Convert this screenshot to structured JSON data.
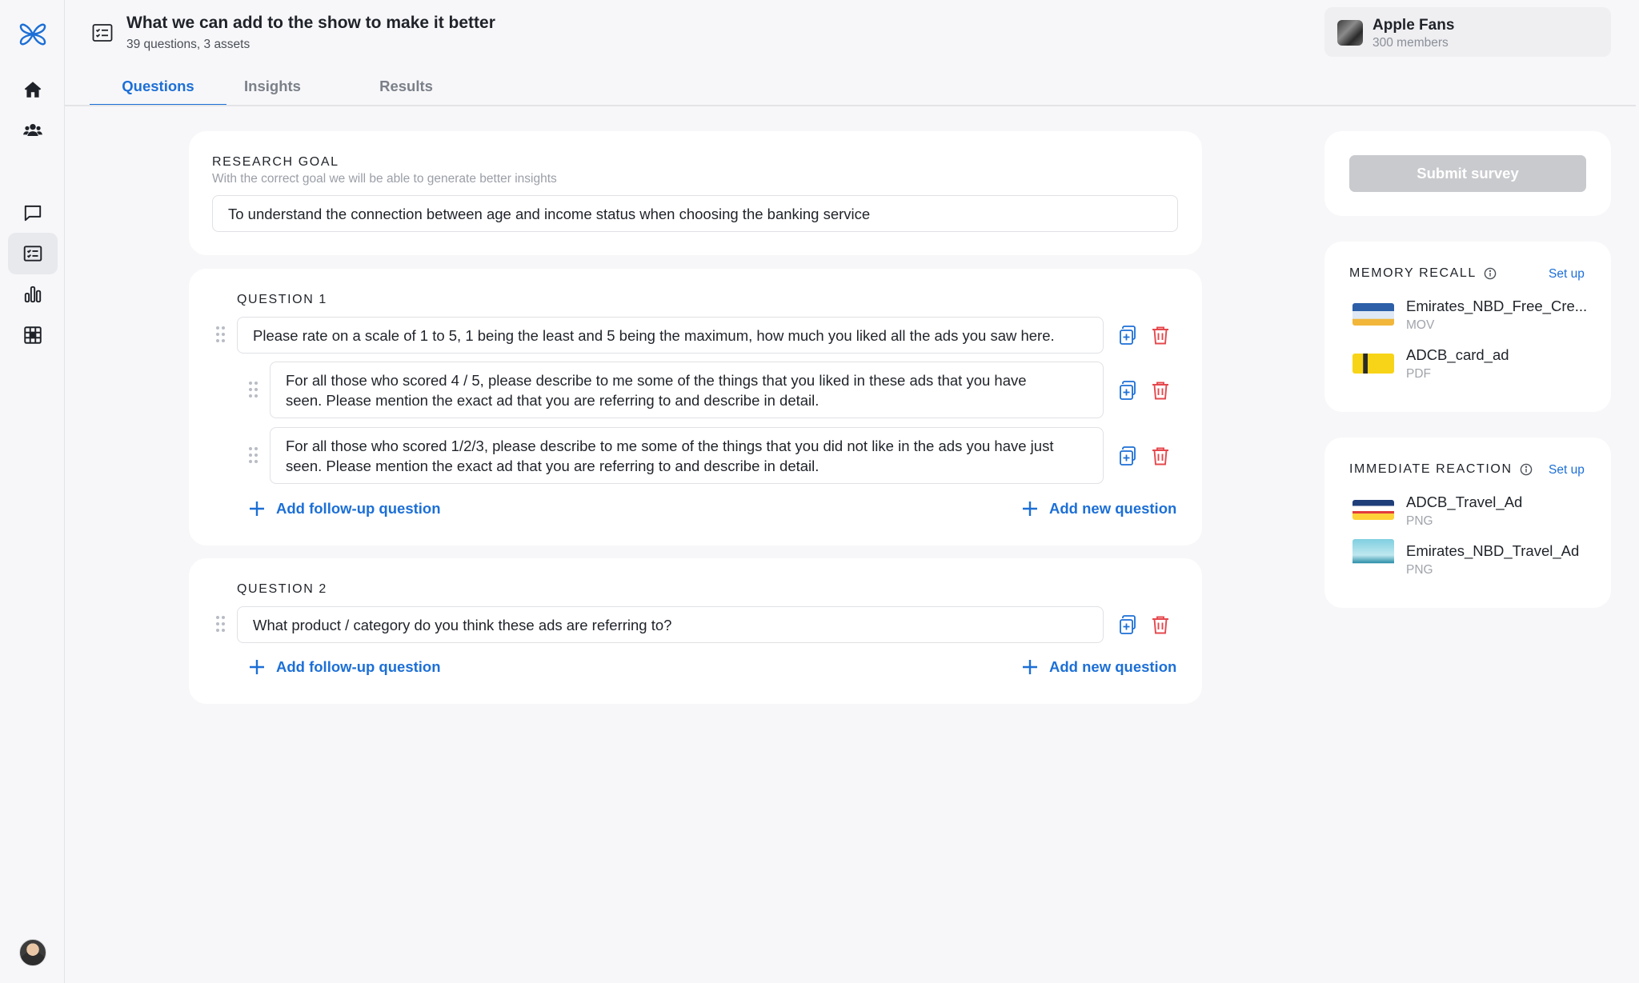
{
  "app": {
    "logo_icon": "butterfly-logo-icon",
    "accent_color": "#1c6fd6",
    "danger_color": "#e5484d"
  },
  "sidebar": {
    "items": [
      {
        "name": "home",
        "icon": "home-icon"
      },
      {
        "name": "audience",
        "icon": "users-icon"
      },
      {
        "name": "chat",
        "icon": "chat-icon"
      },
      {
        "name": "surveys",
        "icon": "survey-list-icon",
        "active": true
      },
      {
        "name": "analytics",
        "icon": "bar-chart-icon"
      },
      {
        "name": "grid",
        "icon": "grid-icon"
      }
    ]
  },
  "header": {
    "title": "What we can add to the show to make it better",
    "subtitle": "39 questions, 3 assets",
    "group": {
      "name": "Apple Fans",
      "members": "300 members"
    }
  },
  "tabs": [
    {
      "label": "Questions",
      "active": true
    },
    {
      "label": "Insights",
      "active": false
    },
    {
      "label": "Results",
      "active": false
    }
  ],
  "research_goal": {
    "label": "RESEARCH GOAL",
    "helper": "With the correct goal we will be able to generate better insights",
    "value": "To understand the connection between age and income status when choosing the banking service"
  },
  "questions": [
    {
      "label": "QUESTION 1",
      "text": "Please rate on a scale of 1 to 5, 1 being the least and 5 being the maximum, how much you liked all the ads you saw here.",
      "followups": [
        {
          "line1": "For all those who scored 4 / 5, please describe to me some of the things that you liked in these ads that you have",
          "line2": "seen. Please mention the exact ad that you are referring to and describe in detail."
        },
        {
          "line1": "For all those who scored 1/2/3, please describe to me some of the things that you did not like in the ads you have just",
          "line2": "seen. Please mention the exact ad that you are referring to and describe in detail."
        }
      ],
      "add_followup": "Add follow-up question",
      "add_new": "Add new question"
    },
    {
      "label": "QUESTION 2",
      "text": "What product / category do you think these ads are referring to?",
      "followups": [],
      "add_followup": "Add follow-up question",
      "add_new": "Add new question"
    }
  ],
  "right_panel": {
    "submit_label": "Submit survey",
    "memory_recall": {
      "title": "MEMORY RECALL",
      "setup_label": "Set up",
      "assets": [
        {
          "name": "Emirates_NBD_Free_Cre...",
          "type": "MOV"
        },
        {
          "name": "ADCB_card_ad",
          "type": "PDF"
        }
      ]
    },
    "immediate_reaction": {
      "title": "IMMEDIATE REACTION",
      "setup_label": "Set up",
      "assets": [
        {
          "name": "ADCB_Travel_Ad",
          "type": "PNG"
        },
        {
          "name": "Emirates_NBD_Travel_Ad",
          "type": "PNG"
        }
      ]
    }
  }
}
